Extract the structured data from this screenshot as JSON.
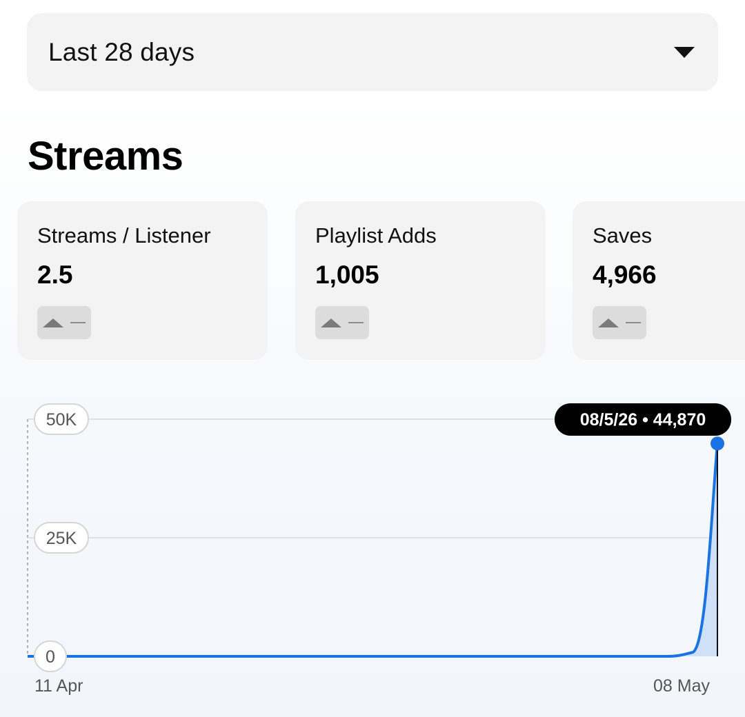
{
  "filter": {
    "selected": "Last 28 days"
  },
  "section_title": "Streams",
  "cards": [
    {
      "label": "Streams / Listener",
      "value": "2.5"
    },
    {
      "label": "Playlist Adds",
      "value": "1,005"
    },
    {
      "label": "Saves",
      "value": "4,966"
    }
  ],
  "tooltip": {
    "text": "08/5/26 • 44,870"
  },
  "chart_data": {
    "type": "area",
    "title": "",
    "xlabel": "",
    "ylabel": "",
    "x_tick_labels": [
      "11 Apr",
      "08 May"
    ],
    "y_ticks": [
      0,
      25000,
      50000
    ],
    "y_tick_labels": [
      "0",
      "25K",
      "50K"
    ],
    "ylim": [
      0,
      50000
    ],
    "series": [
      {
        "x": [
          "2026-04-11",
          "2026-04-12",
          "2026-04-13",
          "2026-04-14",
          "2026-04-15",
          "2026-04-16",
          "2026-04-17",
          "2026-04-18",
          "2026-04-19",
          "2026-04-20",
          "2026-04-21",
          "2026-04-22",
          "2026-04-23",
          "2026-04-24",
          "2026-04-25",
          "2026-04-26",
          "2026-04-27",
          "2026-04-28",
          "2026-04-29",
          "2026-04-30",
          "2026-05-01",
          "2026-05-02",
          "2026-05-03",
          "2026-05-04",
          "2026-05-05",
          "2026-05-06",
          "2026-05-07",
          "2026-05-08"
        ],
        "values": [
          0,
          0,
          0,
          0,
          0,
          0,
          0,
          0,
          0,
          0,
          0,
          0,
          0,
          0,
          0,
          0,
          0,
          0,
          0,
          0,
          0,
          0,
          0,
          0,
          0,
          0,
          800,
          44870
        ]
      }
    ],
    "highlight": {
      "x": "2026-05-08",
      "y": 44870
    },
    "grid": true
  },
  "colors": {
    "line": "#1a73e0",
    "area": "#cfe0f7",
    "grid": "#d9d9d9",
    "tooltip_bg": "#000000",
    "tooltip_text": "#ffffff"
  }
}
